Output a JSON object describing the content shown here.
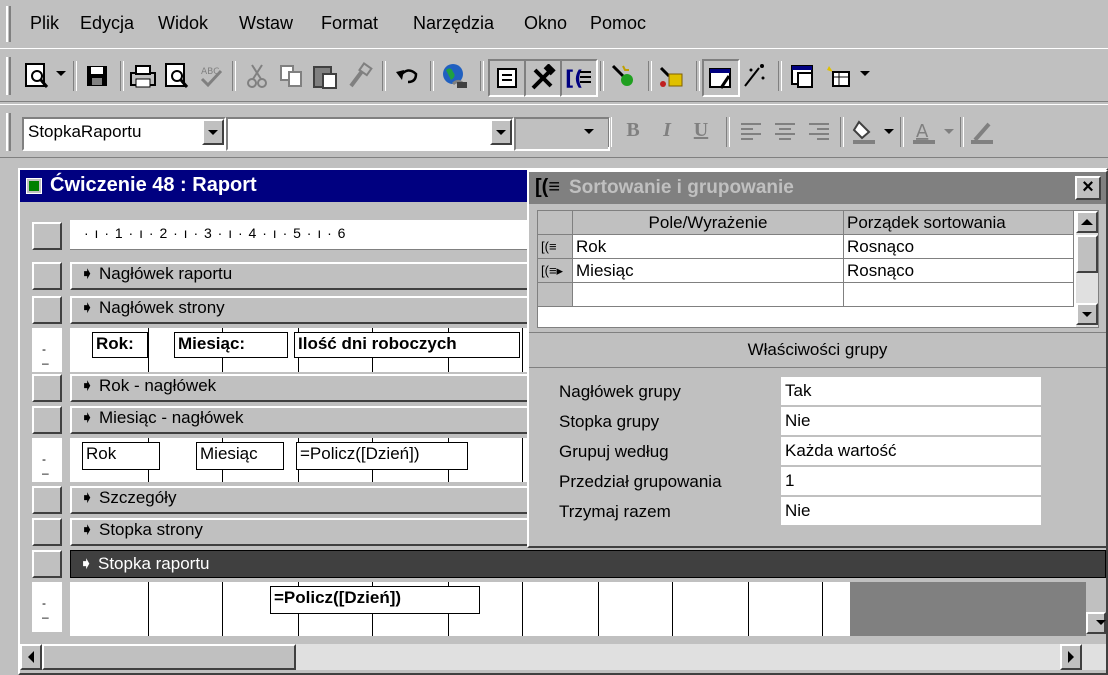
{
  "menu": {
    "items": [
      {
        "label": "Plik"
      },
      {
        "label": "Edycja"
      },
      {
        "label": "Widok"
      },
      {
        "label": "Wstaw"
      },
      {
        "label": "Format"
      },
      {
        "label": "Narzędzia"
      },
      {
        "label": "Okno"
      },
      {
        "label": "Pomoc"
      }
    ]
  },
  "toolbar": {
    "icons": [
      "view-icon",
      "save-icon",
      "print-icon",
      "print-preview-icon",
      "spelling-icon",
      "cut-icon",
      "copy-icon",
      "paste-icon",
      "format-painter-icon",
      "undo-icon",
      "internet-icon",
      "field-list-icon",
      "toolbox-icon",
      "sorting-grouping-icon",
      "autoformat-icon",
      "code-icon",
      "properties-icon",
      "build-icon",
      "database-window-icon",
      "new-object-icon"
    ]
  },
  "format_toolbar": {
    "object_combo": "StopkaRaportu",
    "font_combo": "",
    "size_combo": "",
    "bold": "B",
    "italic": "I",
    "underline": "U"
  },
  "report": {
    "title": "Ćwiczenie 48 : Raport",
    "ruler_text": "· ı · 1 · ı · 2 · ı · 3 · ı · 4 · ı · 5 · ı · 6",
    "bands": {
      "report_header": "Nagłówek raportu",
      "page_header": "Nagłówek strony",
      "year_header": "Rok - nagłówek",
      "month_header": "Miesiąc - nagłówek",
      "details": "Szczegóły",
      "page_footer": "Stopka strony",
      "report_footer": "Stopka raportu"
    },
    "page_header_fields": [
      "Rok:",
      "Miesiąc:",
      "Ilość dni roboczych"
    ],
    "month_header_fields": [
      "Rok",
      "Miesiąc",
      "=Policz([Dzień])"
    ],
    "report_footer_field": "=Policz([Dzień])"
  },
  "dialog": {
    "title": "Sortowanie i grupowanie",
    "close": "×",
    "columns": [
      "Pole/Wyrażenie",
      "Porządek sortowania"
    ],
    "rows": [
      {
        "field": "Rok",
        "order": "Rosnąco"
      },
      {
        "field": "Miesiąc",
        "order": "Rosnąco"
      },
      {
        "field": "",
        "order": ""
      }
    ],
    "group_props_title": "Właściwości grupy",
    "props": [
      {
        "label": "Nagłówek grupy",
        "value": "Tak"
      },
      {
        "label": "Stopka grupy",
        "value": "Nie"
      },
      {
        "label": "Grupuj według",
        "value": "Każda wartość"
      },
      {
        "label": "Przedział grupowania",
        "value": "1"
      },
      {
        "label": "Trzymaj razem",
        "value": "Nie"
      }
    ]
  }
}
